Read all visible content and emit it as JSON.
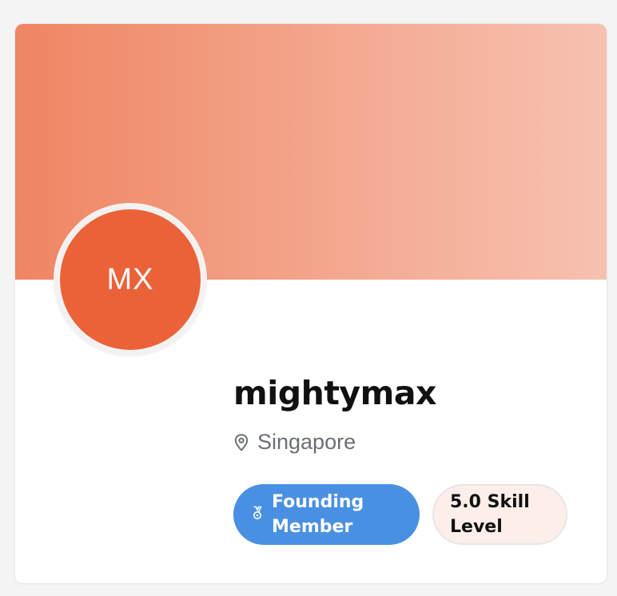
{
  "profile": {
    "initials": "MX",
    "username": "mightymax",
    "location": "Singapore",
    "location_icon": "map-pin-icon",
    "badges": {
      "founding": {
        "label": "Founding Member",
        "icon": "medal-icon",
        "color": "#4a90e2"
      },
      "skill": {
        "label": "5.0 Skill Level",
        "color": "#fdeeea"
      }
    }
  },
  "colors": {
    "avatar_bg": "#eb6239",
    "banner_start": "#ef8563",
    "banner_end": "#f7c1b1",
    "background": "#f4f4f4"
  }
}
